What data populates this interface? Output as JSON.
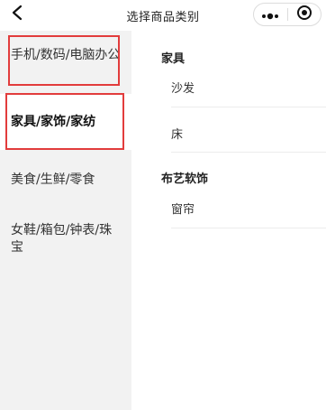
{
  "header": {
    "title": "选择商品类别",
    "back_icon": "chevron-left-icon",
    "more_icon": "more-dots-icon",
    "close_icon": "target-circle-icon"
  },
  "sidebar": {
    "items": [
      {
        "label": "手机/数码/电脑办公",
        "active": false
      },
      {
        "label": "家具/家饰/家纺",
        "active": true
      },
      {
        "label": "美食/生鲜/零食",
        "active": false
      },
      {
        "label": "女鞋/箱包/钟表/珠宝",
        "active": false
      }
    ]
  },
  "content": {
    "groups": [
      {
        "title": "家具",
        "items": [
          "沙发",
          "床"
        ]
      },
      {
        "title": "布艺软饰",
        "items": [
          "窗帘"
        ]
      }
    ]
  },
  "colors": {
    "highlight_border": "#e23c3c",
    "sidebar_bg": "#f2f2f2",
    "active_bg": "#ffffff"
  }
}
